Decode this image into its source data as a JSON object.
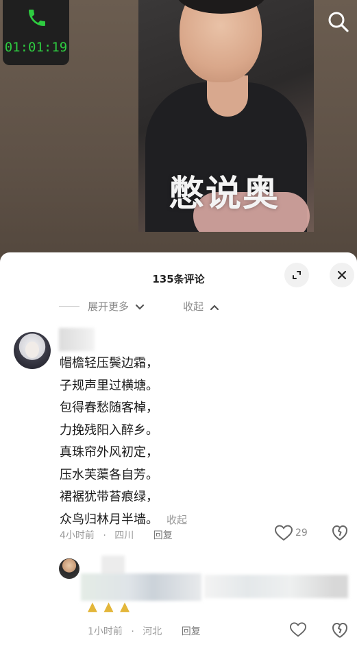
{
  "call": {
    "timer": "01:01:19",
    "icon": "phone-icon"
  },
  "video": {
    "caption": "憋说奥"
  },
  "search": {
    "icon": "search-icon"
  },
  "comments": {
    "title": "135条评论",
    "expand_more": "展开更多",
    "collapse": "收起",
    "main_comment": {
      "lines": [
        "帽檐轻压鬓边霜，",
        "子规声里过横塘。",
        "包得春愁随客棹，",
        "力挽残阳入醉乡。",
        "真珠帘外风初定，",
        "压水芙蕖各自芳。",
        "裙裾犹带苔痕绿，",
        "众鸟归林月半墙。"
      ],
      "inline_collapse": "收起",
      "time": "4小时前",
      "location": "四川",
      "reply_label": "回复",
      "like_count": "29"
    },
    "reply_comment": {
      "time": "1小时前",
      "location": "河北",
      "reply_label": "回复"
    }
  },
  "colors": {
    "timer_green": "#2ecc40",
    "sheet_bg": "#ffffff",
    "muted_text": "#9a9a9a"
  }
}
